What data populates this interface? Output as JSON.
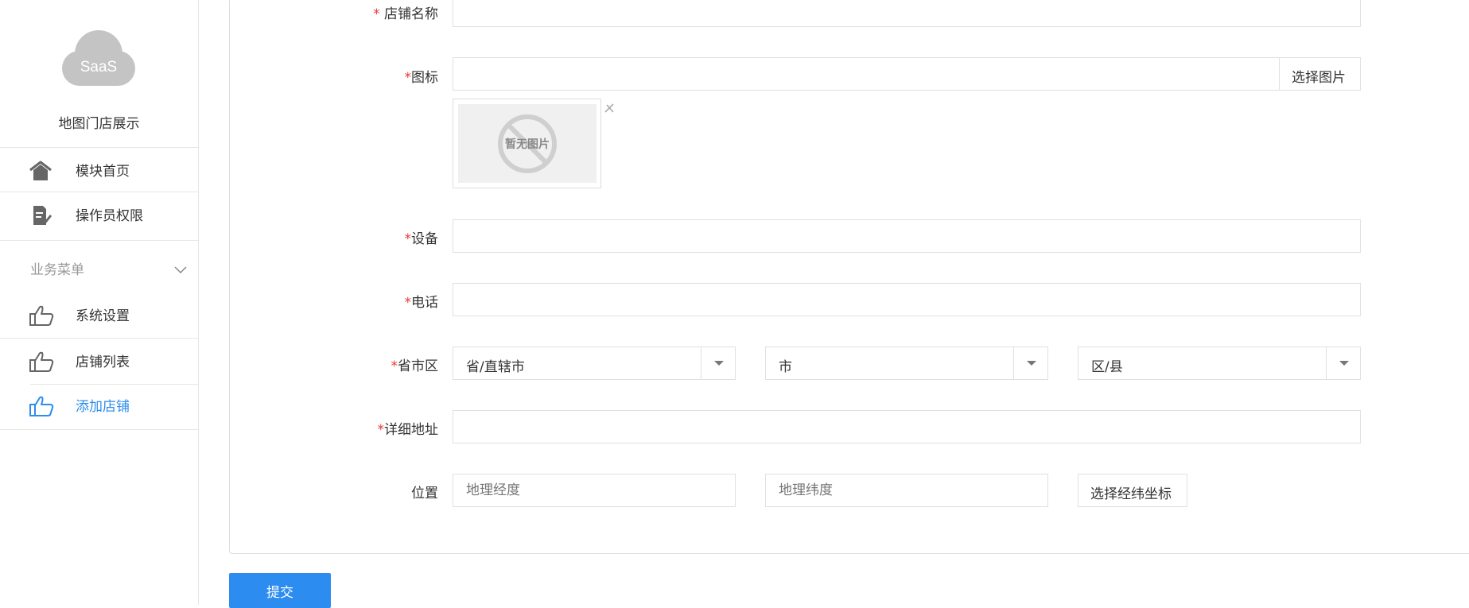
{
  "sidebar": {
    "logo_text": "SaaS",
    "app_title": "地图门店展示",
    "top_items": [
      {
        "label": "模块首页",
        "icon": "home-icon"
      },
      {
        "label": "操作员权限",
        "icon": "document-edit-icon"
      }
    ],
    "group": {
      "label": "业务菜单",
      "icon": "chevron-down-icon"
    },
    "group_items": [
      {
        "label": "系统设置",
        "icon": "thumbs-up-icon"
      },
      {
        "label": "店铺列表",
        "icon": "thumbs-up-icon"
      },
      {
        "label": "添加店铺",
        "icon": "thumbs-up-icon",
        "active": true
      }
    ]
  },
  "form": {
    "shop_name": {
      "required_mark": "*",
      "label": "店铺名称",
      "value": ""
    },
    "icon_field": {
      "required_mark": "*",
      "label": "图标",
      "value": "",
      "button": "选择图片"
    },
    "thumbnail": {
      "placeholder_text": "暂无图片",
      "remove_icon": "close-icon"
    },
    "device": {
      "required_mark": "*",
      "label": "设备",
      "value": ""
    },
    "phone": {
      "required_mark": "*",
      "label": "电话",
      "value": ""
    },
    "region": {
      "required_mark": "*",
      "label": "省市区",
      "province": "省/直辖市",
      "city": "市",
      "district": "区/县"
    },
    "address": {
      "required_mark": "*",
      "label": "详细地址",
      "value": ""
    },
    "location": {
      "label": "位置",
      "longitude_placeholder": "地理经度",
      "latitude_placeholder": "地理纬度",
      "button": "选择经纬坐标"
    },
    "submit": "提交"
  },
  "colors": {
    "accent": "#2d8cf0",
    "required": "#e4393c",
    "border": "#e0e0e0"
  }
}
